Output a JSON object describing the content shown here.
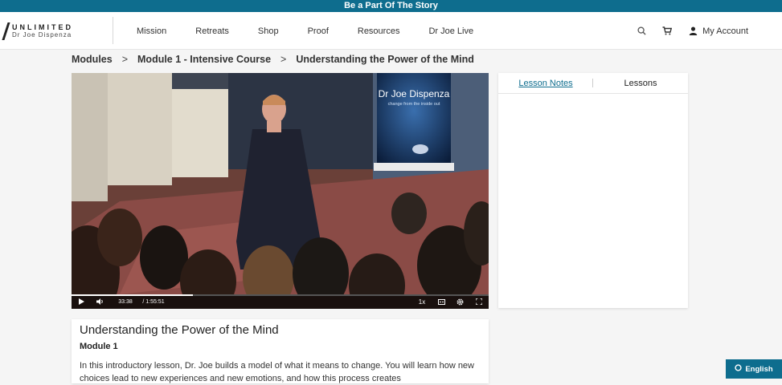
{
  "banner": {
    "text": "Be a Part Of The Story"
  },
  "brand": {
    "line1": "UNLIMITED",
    "line2": "Dr Joe Dispenza"
  },
  "nav": {
    "items": [
      "Mission",
      "Retreats",
      "Shop",
      "Proof",
      "Resources",
      "Dr Joe Live"
    ],
    "account_label": "My Account",
    "icons": [
      "search-icon",
      "cart-icon",
      "user-icon"
    ]
  },
  "breadcrumb": {
    "items": [
      "Modules",
      "Module 1 - Intensive Course",
      "Understanding the Power of the Mind"
    ],
    "separator": ">"
  },
  "video": {
    "stage_sign_title": "Dr Joe Dispenza",
    "stage_sign_subtitle": "change from the inside out",
    "current_time": "33:38",
    "duration": "/ 1:55:51",
    "progress_fraction": 0.29,
    "speed": "1x",
    "icons": [
      "play-icon",
      "volume-icon",
      "captions-icon",
      "settings-icon",
      "fullscreen-icon"
    ]
  },
  "lesson": {
    "title": "Understanding the Power of the Mind",
    "module": "Module 1",
    "description": "In this introductory lesson, Dr. Joe builds a model of what it means to change. You will learn how new choices lead to new experiences and new emotions, and how this process creates"
  },
  "side_panel": {
    "tabs": [
      "Lesson Notes",
      "Lessons"
    ],
    "active_tab": 0
  },
  "language": {
    "label": "English"
  },
  "colors": {
    "brand_teal": "#0e6d8e",
    "arrow_red": "#e31c1c"
  }
}
